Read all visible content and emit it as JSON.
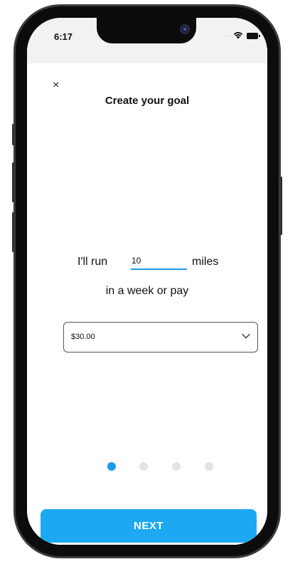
{
  "status_bar": {
    "time": "6:17",
    "signal_dots": "....",
    "icons": [
      "wifi-icon",
      "battery-icon"
    ]
  },
  "header": {
    "close_icon": "×",
    "title": "Create your goal"
  },
  "goal": {
    "prefix": "I'll run",
    "distance_value": "10",
    "unit": "miles",
    "period_text": "in a week or pay"
  },
  "stake_select": {
    "selected": "$30.00",
    "icon": "chevron-down-icon"
  },
  "pager": {
    "total": 4,
    "active_index": 0
  },
  "footer": {
    "next_label": "NEXT"
  },
  "colors": {
    "accent": "#1a9bf0",
    "button": "#1ca9f2",
    "inactive_dot": "#e3e3e6"
  }
}
